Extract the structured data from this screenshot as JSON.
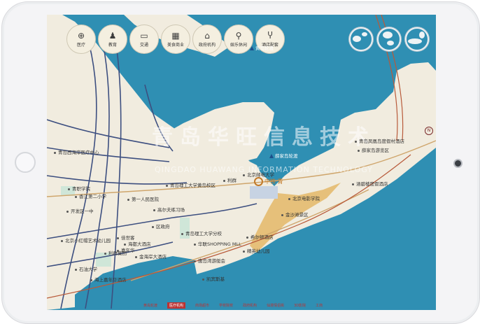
{
  "categories": [
    {
      "label": "医疗",
      "icon": "medical-icon",
      "glyph": "⊕"
    },
    {
      "label": "教育",
      "icon": "education-icon",
      "glyph": "♟"
    },
    {
      "label": "交通",
      "icon": "transport-icon",
      "glyph": "▭"
    },
    {
      "label": "美食商业",
      "icon": "shopping-icon",
      "glyph": "▦"
    },
    {
      "label": "政府机构",
      "icon": "government-icon",
      "glyph": "⌂"
    },
    {
      "label": "娱乐休闲",
      "icon": "leisure-icon",
      "glyph": "⚲"
    },
    {
      "label": "酒店配套",
      "icon": "hotel-icon",
      "glyph": "Ⴤ"
    }
  ],
  "watermark": {
    "cn": "青岛华旺信息技术",
    "en": "QINGDAO HUAWANG INFORMATION TECHNOLOGY"
  },
  "landmark": "中铁·青",
  "ferry_labels": [
    {
      "id": "ferry-top",
      "text": "黄岛轮渡"
    },
    {
      "id": "ferry-mid",
      "text": "薛家岛轮渡"
    }
  ],
  "labels": [
    {
      "id": "l1",
      "text": "青岛西海岸医疗中心"
    },
    {
      "id": "l2",
      "text": "青职学院"
    },
    {
      "id": "l3",
      "text": "香江第二小学"
    },
    {
      "id": "l4",
      "text": "开发区一中"
    },
    {
      "id": "l5",
      "text": "第一人民医院"
    },
    {
      "id": "l6",
      "text": "高尔夫练习场"
    },
    {
      "id": "l7",
      "text": "青岛理工大学黄岛校区"
    },
    {
      "id": "l8",
      "text": "区政府"
    },
    {
      "id": "l9",
      "text": "北京小红帽艺术幼儿园"
    },
    {
      "id": "l10",
      "text": "佳世客"
    },
    {
      "id": "l11",
      "text": "海都大酒店"
    },
    {
      "id": "l12",
      "text": "利群集团"
    },
    {
      "id": "l13",
      "text": "嘉年华"
    },
    {
      "id": "l14",
      "text": "金海岸大酒店"
    },
    {
      "id": "l15",
      "text": "石油大学"
    },
    {
      "id": "l16",
      "text": "海上嘉年华酒店"
    },
    {
      "id": "l17",
      "text": "青岛理工大学分校"
    },
    {
      "id": "l18",
      "text": "华联SHOPPING MLL"
    },
    {
      "id": "l19",
      "text": "唐岛湾游艇会"
    },
    {
      "id": "l20",
      "text": "希尔顿酒店"
    },
    {
      "id": "l21",
      "text": "精英幼儿园"
    },
    {
      "id": "l22",
      "text": "凯宾斯基"
    },
    {
      "id": "l23",
      "text": "北京电影学院"
    },
    {
      "id": "l24",
      "text": "金沙滩景区"
    },
    {
      "id": "l25",
      "text": "青岛凤凰岛度假村酒店"
    },
    {
      "id": "l26",
      "text": "薛家岛游览区"
    },
    {
      "id": "l27",
      "text": "涵碧楼度假酒店"
    },
    {
      "id": "l28",
      "text": "利群"
    },
    {
      "id": "l29",
      "text": "北京邮电大学"
    }
  ],
  "bottom_items": [
    "黄岛轮渡",
    "医疗机构",
    "商场超市",
    "学校院校",
    "政府机构",
    "仙境情侣街",
    "3D影院",
    "工商"
  ],
  "bottom_selected_index": 1,
  "compass": "N",
  "colors": {
    "water": "#2f8fb3",
    "land": "#f1ecdf",
    "road": "#3d4f80",
    "beach": "#e6c07a",
    "park": "#cfe6d8",
    "railway": "#b85a3a"
  }
}
